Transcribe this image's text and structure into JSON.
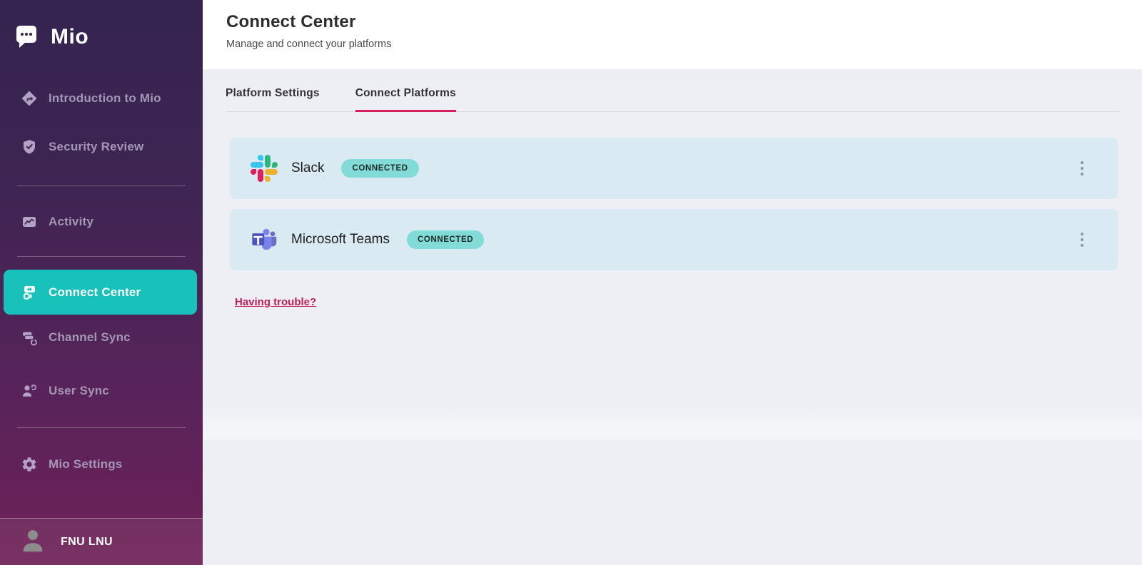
{
  "app": {
    "brand": "Mio"
  },
  "sidebar": {
    "items": [
      {
        "label": "Introduction to Mio",
        "icon": "directions-icon"
      },
      {
        "label": "Security Review",
        "icon": "shield-check-icon"
      },
      {
        "label": "Activity",
        "icon": "activity-chart-icon"
      },
      {
        "label": "Connect Center",
        "icon": "connect-icon",
        "active": true
      },
      {
        "label": "Channel Sync",
        "icon": "channel-sync-icon"
      },
      {
        "label": "User Sync",
        "icon": "user-sync-icon"
      },
      {
        "label": "Mio Settings",
        "icon": "gear-icon"
      }
    ],
    "user": {
      "name": "FNU LNU"
    }
  },
  "header": {
    "title": "Connect Center",
    "subtitle": "Manage and connect your platforms"
  },
  "tabs": {
    "platform_settings": "Platform Settings",
    "connect_platforms": "Connect Platforms",
    "active": "Connect Platforms"
  },
  "platforms": [
    {
      "name": "Slack",
      "status": "CONNECTED"
    },
    {
      "name": "Microsoft Teams",
      "status": "CONNECTED"
    }
  ],
  "links": {
    "having_trouble": "Having trouble?"
  },
  "colors": {
    "sidebar_top": "#35254f",
    "sidebar_bottom": "#6f2257",
    "active_item_teal": "#18c1ba",
    "tab_accent": "#d6205e",
    "main_bg": "#edeff4",
    "card_bg": "#d9eaf2",
    "badge_bg": "#82dbd6",
    "link": "#c01e5c",
    "slack_blue": "#36C5F0",
    "slack_green": "#2EB67D",
    "slack_red": "#E01E5A",
    "slack_yellow": "#ECB22E",
    "teams_purple": "#7b83eb"
  }
}
